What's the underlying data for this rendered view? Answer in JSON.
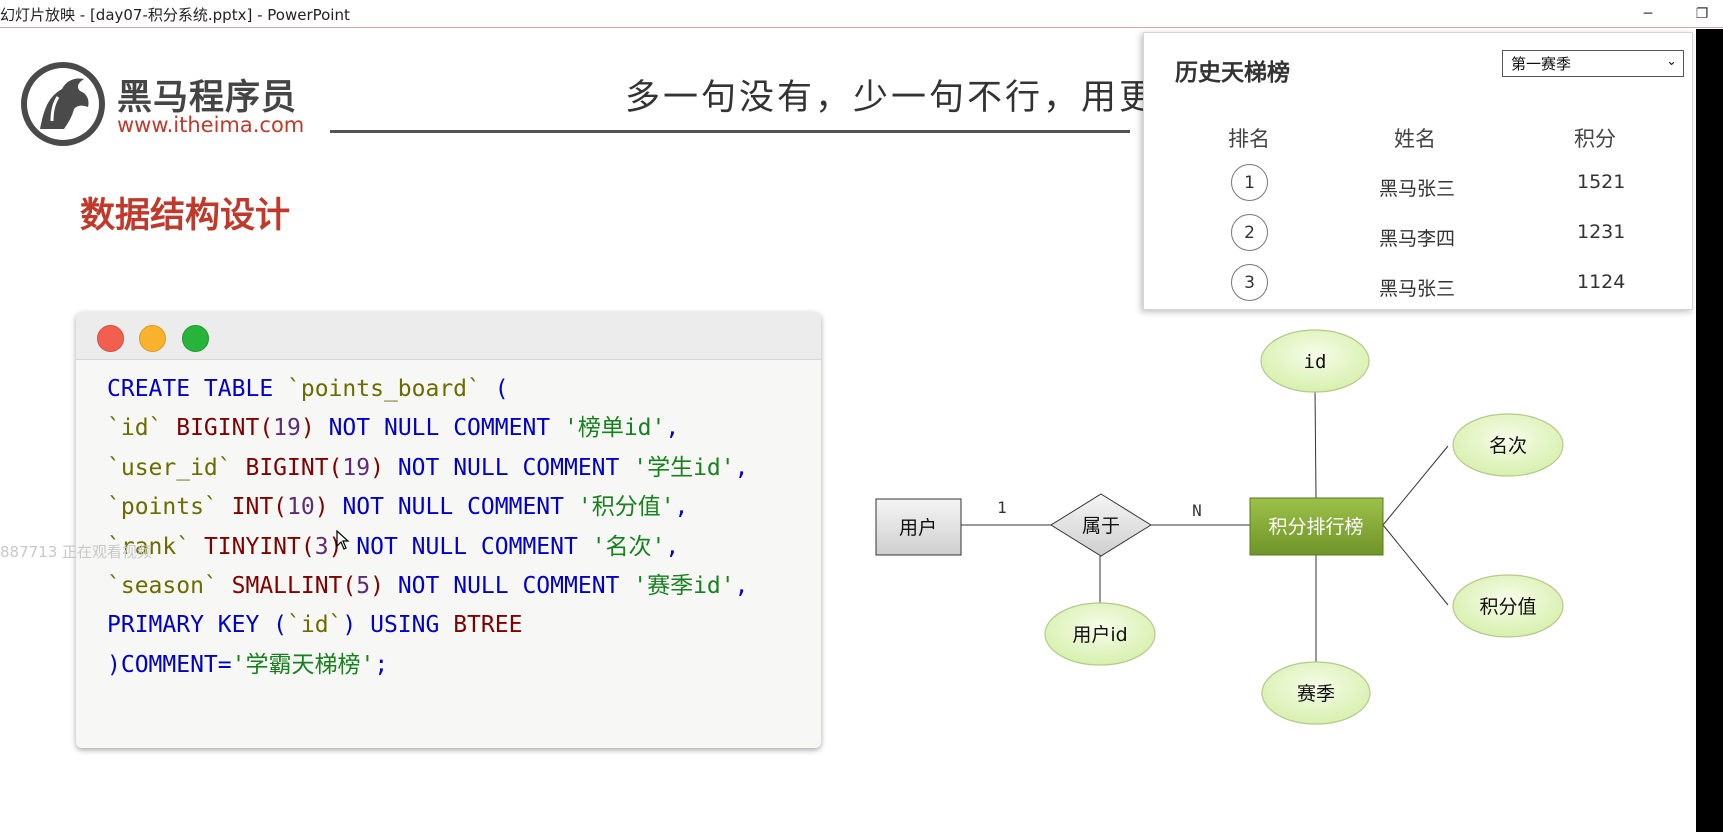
{
  "window": {
    "title": "幻灯片放映 - [day07-积分系统.pptx] - PowerPoint",
    "minimize_label": "─",
    "restore_label": "❐"
  },
  "slide": {
    "logo": {
      "name": "黑马程序员",
      "url": "www.itheima.com"
    },
    "slogan": "多一句没有，少一句不行，用更",
    "section_title": "数据结构设计",
    "watermark": "887713 正在观看视频",
    "code": {
      "lines": [
        [
          {
            "c": "k",
            "v": "CREATE TABLE "
          },
          {
            "c": "id",
            "v": "`points_board`"
          },
          {
            "c": "k",
            "v": " ("
          }
        ],
        [
          {
            "c": "id",
            "v": "`id`"
          },
          {
            "c": "t",
            "v": " BIGINT("
          },
          {
            "c": "n",
            "v": "19"
          },
          {
            "c": "t",
            "v": ")"
          },
          {
            "c": "k",
            "v": " NOT NULL COMMENT "
          },
          {
            "c": "s",
            "v": "'榜单id'"
          },
          {
            "c": "k",
            "v": ","
          }
        ],
        [
          {
            "c": "id",
            "v": "`user_id`"
          },
          {
            "c": "t",
            "v": " BIGINT("
          },
          {
            "c": "n",
            "v": "19"
          },
          {
            "c": "t",
            "v": ")"
          },
          {
            "c": "k",
            "v": " NOT NULL COMMENT "
          },
          {
            "c": "s",
            "v": "'学生id'"
          },
          {
            "c": "k",
            "v": ","
          }
        ],
        [
          {
            "c": "id",
            "v": "`points`"
          },
          {
            "c": "t",
            "v": " INT("
          },
          {
            "c": "n",
            "v": "10"
          },
          {
            "c": "t",
            "v": ")"
          },
          {
            "c": "k",
            "v": " NOT NULL COMMENT "
          },
          {
            "c": "s",
            "v": "'积分值'"
          },
          {
            "c": "k",
            "v": ","
          }
        ],
        [
          {
            "c": "id",
            "v": "`rank`"
          },
          {
            "c": "t",
            "v": " TINYINT("
          },
          {
            "c": "n",
            "v": "3"
          },
          {
            "c": "t",
            "v": ")"
          },
          {
            "c": "k",
            "v": " NOT NULL COMMENT "
          },
          {
            "c": "s",
            "v": "'名次'"
          },
          {
            "c": "k",
            "v": ","
          }
        ],
        [
          {
            "c": "id",
            "v": "`season`"
          },
          {
            "c": "t",
            "v": " SMALLINT("
          },
          {
            "c": "n",
            "v": "5"
          },
          {
            "c": "t",
            "v": ")"
          },
          {
            "c": "k",
            "v": " NOT NULL COMMENT "
          },
          {
            "c": "s",
            "v": "'赛季id'"
          },
          {
            "c": "k",
            "v": ","
          }
        ],
        [
          {
            "c": "k",
            "v": "PRIMARY KEY ("
          },
          {
            "c": "id",
            "v": "`id`"
          },
          {
            "c": "k",
            "v": ") USING "
          },
          {
            "c": "t",
            "v": "BTREE"
          }
        ],
        [
          {
            "c": "k",
            "v": ")COMMENT="
          },
          {
            "c": "s",
            "v": "'学霸天梯榜'"
          },
          {
            "c": "k",
            "v": ";"
          }
        ]
      ]
    },
    "er": {
      "entity_user": "用户",
      "relation": "属于",
      "entity_board": "积分排行榜",
      "card_left": "1",
      "card_right": "N",
      "attr_id": "id",
      "attr_rank": "名次",
      "attr_points": "积分值",
      "attr_season": "赛季",
      "attr_user_id": "用户id"
    }
  },
  "board": {
    "title": "历史天梯榜",
    "select": {
      "value": "第一赛季",
      "options": [
        "第一赛季"
      ]
    },
    "headers": {
      "rank": "排名",
      "name": "姓名",
      "points": "积分"
    },
    "rows": [
      {
        "rank": "1",
        "name": "黑马张三",
        "points": "1521"
      },
      {
        "rank": "2",
        "name": "黑马李四",
        "points": "1231"
      },
      {
        "rank": "3",
        "name": "黑马张三",
        "points": "1124"
      }
    ]
  },
  "colors": {
    "accent_red": "#c0392b",
    "entity_green": "#7ea335",
    "attr_fill": "#e4f5c8"
  },
  "icons": [
    "logo-horse-icon",
    "minimize-icon",
    "restore-icon",
    "chevron-down-icon",
    "mouse-cursor-icon"
  ]
}
